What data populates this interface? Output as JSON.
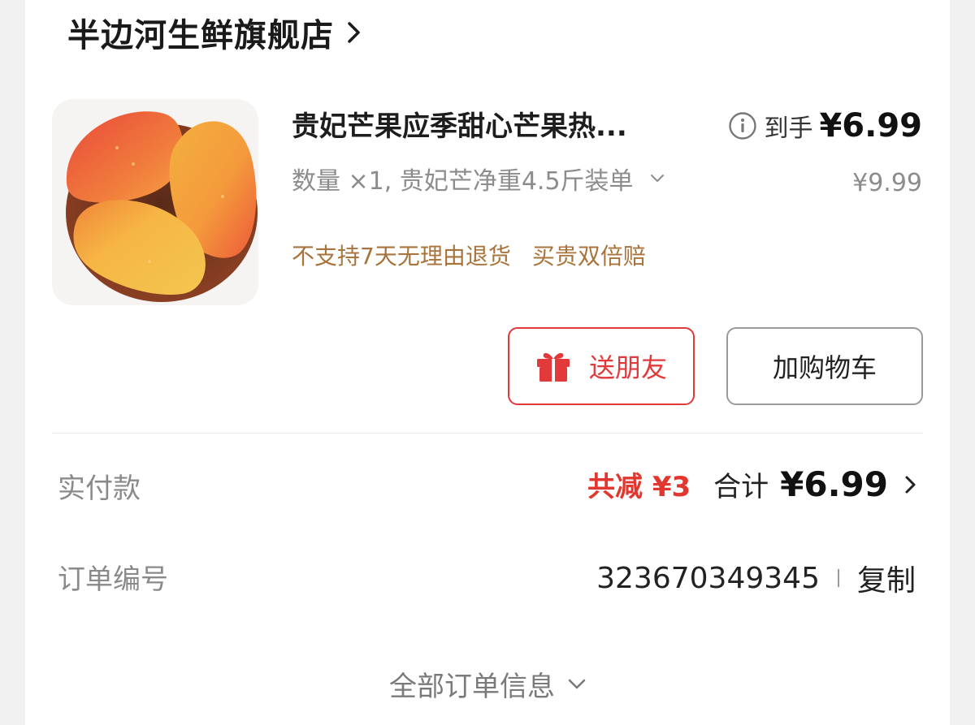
{
  "store": {
    "name": "半边河生鲜旗舰店",
    "icon": "chevron-right-icon"
  },
  "product": {
    "image_icon": "mango-image",
    "title": "贵妃芒果应季甜心芒果热...",
    "spec": "数量 ×1, 贵妃芒净重4.5斤装单",
    "policies": [
      "不支持7天无理由退货",
      "买贵双倍赔"
    ],
    "price_label": "到手",
    "price": "¥6.99",
    "original_price": "¥9.99"
  },
  "actions": {
    "gift_label": "送朋友",
    "cart_label": "加购物车"
  },
  "payment": {
    "label": "实付款",
    "discount": "共减 ¥3",
    "total_label": "合计",
    "total": "¥6.99"
  },
  "order": {
    "label": "订单编号",
    "number": "323670349345",
    "copy_label": "复制"
  },
  "footer": {
    "all_info_label": "全部订单信息"
  },
  "colors": {
    "accent_red": "#e2372f",
    "policy_gold": "#a8743b",
    "muted_gray": "#8c8c8c"
  }
}
